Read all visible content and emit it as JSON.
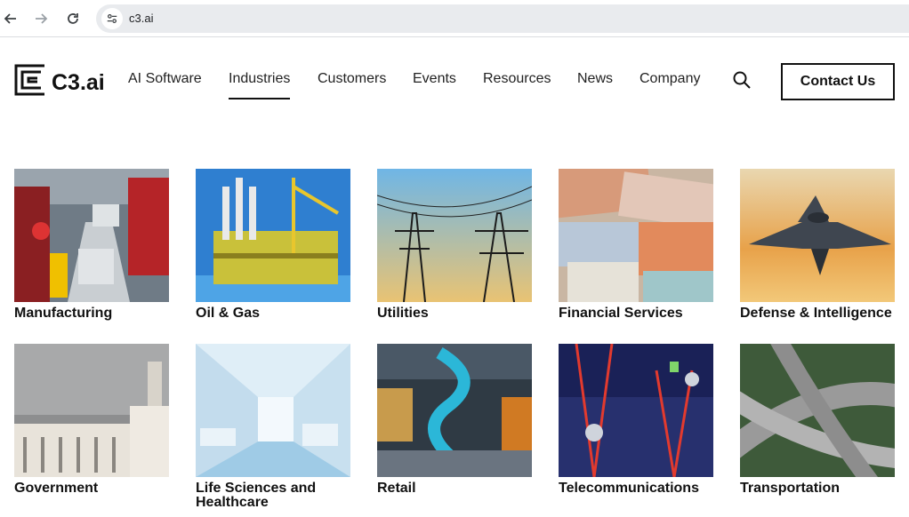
{
  "browser": {
    "url": "c3.ai"
  },
  "header": {
    "logo_text": "C3.ai",
    "nav": [
      {
        "label": "AI Software"
      },
      {
        "label": "Industries"
      },
      {
        "label": "Customers"
      },
      {
        "label": "Events"
      },
      {
        "label": "Resources"
      },
      {
        "label": "News"
      },
      {
        "label": "Company"
      }
    ],
    "active_nav": "Industries",
    "contact_label": "Contact Us"
  },
  "industries": [
    {
      "label": "Manufacturing"
    },
    {
      "label": "Oil & Gas"
    },
    {
      "label": "Utilities"
    },
    {
      "label": "Financial Services"
    },
    {
      "label": "Defense & Intelligence"
    },
    {
      "label": "Government"
    },
    {
      "label": "Life Sciences and Healthcare"
    },
    {
      "label": "Retail"
    },
    {
      "label": "Telecommunications"
    },
    {
      "label": "Transportation"
    }
  ]
}
